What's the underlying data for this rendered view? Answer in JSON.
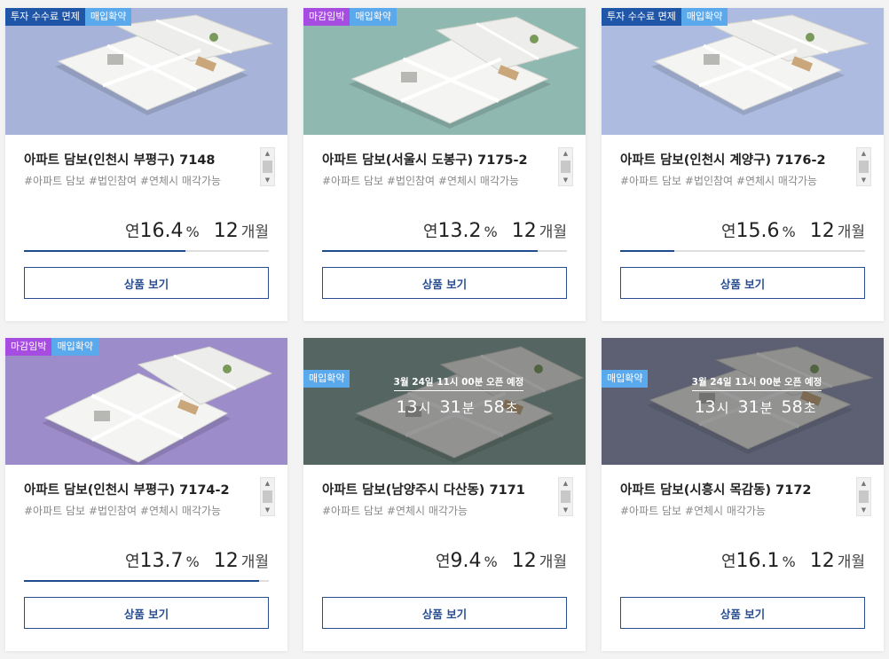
{
  "products": [
    {
      "tags": [
        {
          "label": "투자 수수료 면제",
          "color": "#1f56a8"
        },
        {
          "label": "매입확약",
          "color": "#5aa9ec"
        }
      ],
      "bg": "#a7b3d9",
      "title": "아파트 담보(인천시 부평구) 7148",
      "hashtags": "#아파트 담보 #법인참여 #연체시 매각가능",
      "rate_prefix": "연",
      "rate": "16.4",
      "rate_unit": "%",
      "term": "12",
      "term_unit": "개월",
      "progress": 0.66,
      "button": "상품 보기"
    },
    {
      "tags": [
        {
          "label": "마감임박",
          "color": "#a64ce0"
        },
        {
          "label": "매입확약",
          "color": "#5aa9ec"
        }
      ],
      "bg": "#8fb8b0",
      "title": "아파트 담보(서울시 도봉구) 7175-2",
      "hashtags": "#아파트 담보 #법인참여 #연체시 매각가능",
      "rate_prefix": "연",
      "rate": "13.2",
      "rate_unit": "%",
      "term": "12",
      "term_unit": "개월",
      "progress": 0.88,
      "button": "상품 보기"
    },
    {
      "tags": [
        {
          "label": "투자 수수료 면제",
          "color": "#1f56a8"
        },
        {
          "label": "매입확약",
          "color": "#5aa9ec"
        }
      ],
      "bg": "#aebbe0",
      "title": "아파트 담보(인천시 계양구) 7176-2",
      "hashtags": "#아파트 담보 #법인참여 #연체시 매각가능",
      "rate_prefix": "연",
      "rate": "15.6",
      "rate_unit": "%",
      "term": "12",
      "term_unit": "개월",
      "progress": 0.22,
      "button": "상품 보기"
    },
    {
      "tags": [
        {
          "label": "마감임박",
          "color": "#a64ce0"
        },
        {
          "label": "매입확약",
          "color": "#5aa9ec"
        }
      ],
      "bg": "#9d8cca",
      "title": "아파트 담보(인천시 부평구) 7174-2",
      "hashtags": "#아파트 담보 #법인참여 #연체시 매각가능",
      "rate_prefix": "연",
      "rate": "13.7",
      "rate_unit": "%",
      "term": "12",
      "term_unit": "개월",
      "progress": 0.96,
      "button": "상품 보기"
    },
    {
      "tags": [
        {
          "label": "매입확약",
          "color": "#5aa9ec"
        }
      ],
      "bg": "#7f9e96",
      "upcoming": true,
      "open_label": "3월 24일 11시 00분 오픈 예정",
      "countdown": {
        "h": "13",
        "h_unit": "시",
        "m": "31",
        "m_unit": "분",
        "s": "58",
        "s_unit": "초"
      },
      "title": "아파트 담보(남양주시 다산동) 7171",
      "hashtags": "#아파트 담보 #연체시 매각가능",
      "rate_prefix": "연",
      "rate": "9.4",
      "rate_unit": "%",
      "term": "12",
      "term_unit": "개월",
      "progress": 0,
      "button": "상품 보기"
    },
    {
      "tags": [
        {
          "label": "매입확약",
          "color": "#5aa9ec"
        }
      ],
      "bg": "#8f95b8",
      "upcoming": true,
      "open_label": "3월 24일 11시 00분 오픈 예정",
      "countdown": {
        "h": "13",
        "h_unit": "시",
        "m": "31",
        "m_unit": "분",
        "s": "58",
        "s_unit": "초"
      },
      "title": "아파트 담보(시흥시 목감동) 7172",
      "hashtags": "#아파트 담보 #연체시 매각가능",
      "rate_prefix": "연",
      "rate": "16.1",
      "rate_unit": "%",
      "term": "12",
      "term_unit": "개월",
      "progress": 0,
      "button": "상품 보기"
    }
  ]
}
